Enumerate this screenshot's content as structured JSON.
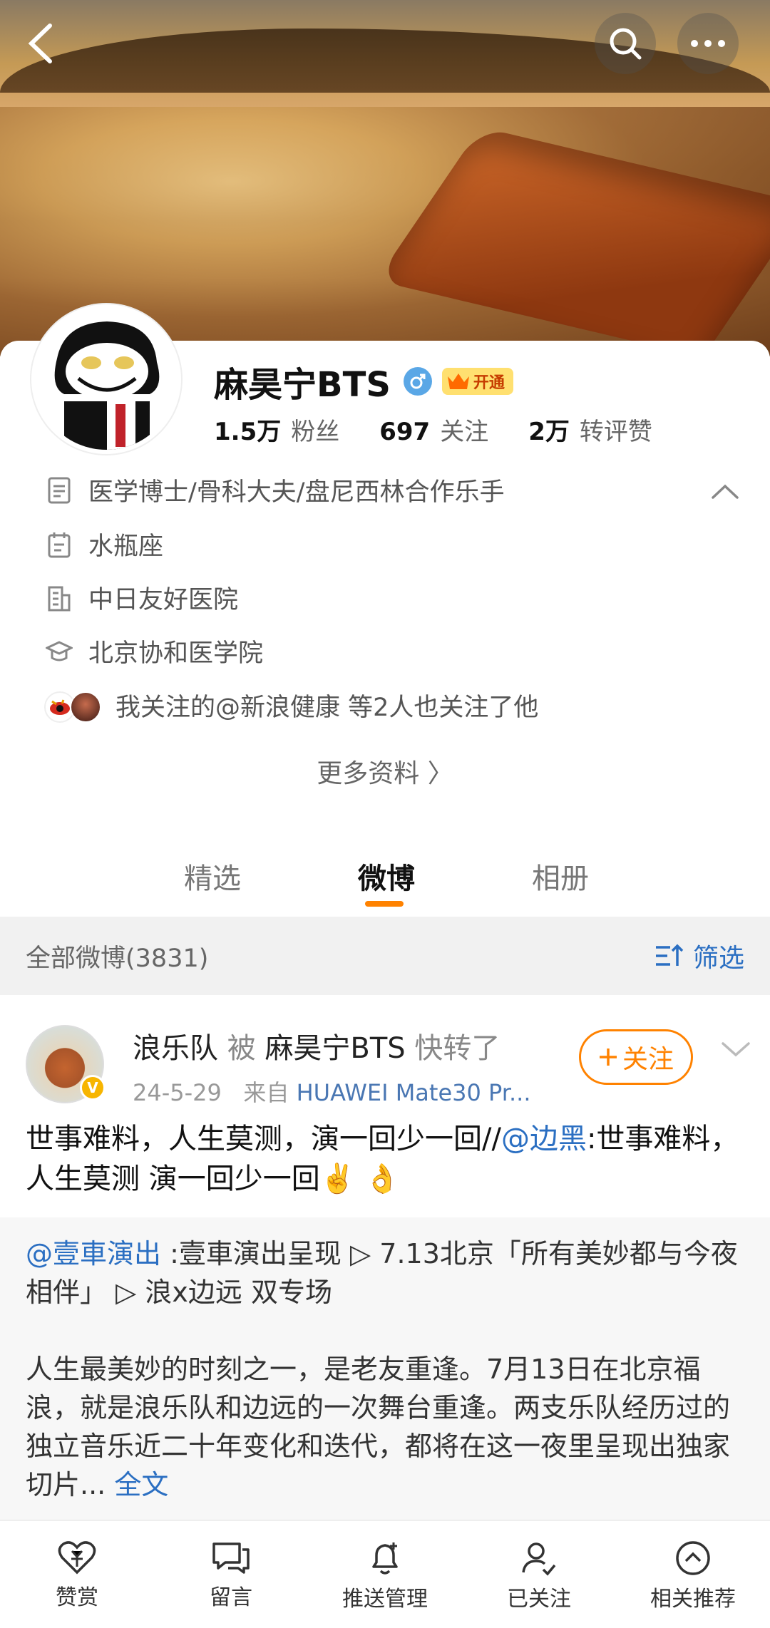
{
  "profile": {
    "name": "麻昊宁BTS",
    "vip_label": "开通",
    "stats": [
      {
        "value": "1.5万",
        "label": "粉丝"
      },
      {
        "value": "697",
        "label": "关注"
      },
      {
        "value": "2万",
        "label": "转评赞"
      }
    ],
    "bio": "医学博士/骨科大夫/盘尼西林合作乐手",
    "constellation": "水瓶座",
    "company": "中日友好医院",
    "school": "北京协和医学院",
    "mutual": "我关注的@新浪健康 等2人也关注了他",
    "more_info": "更多资料 〉"
  },
  "tabs": [
    "精选",
    "微博",
    "相册"
  ],
  "filter": {
    "count_label": "全部微博(3831)",
    "filter_label": "筛选"
  },
  "post": {
    "author": "浪乐队",
    "by": "被",
    "reposter": "麻昊宁BTS",
    "action": "快转了",
    "date": "24-5-29",
    "from": "来自",
    "device": "HUAWEI Mate30 Pr...",
    "follow_label": "关注",
    "text_main": "世事难料，人生莫测，演一回少一回//",
    "text_mention": "@边黑",
    "text_rest": ":世事难料，人生莫测 演一回少一回✌️ 👌",
    "repost_mention": "@壹車演出",
    "repost_line1": " :壹車演出呈现 ▷ 7.13北京「所有美妙都与今夜相伴」 ▷ 浪x边远 双专场",
    "repost_body": "人生最美妙的时刻之一，是老友重逢。7月13日在北京福浪，就是浪乐队和边远的一次舞台重逢。两支乐队经历过的独立音乐近二十年变化和迭代，都将在这一夜里呈现出独家切片...",
    "full_text": "全文"
  },
  "bottom_bar": [
    {
      "label": "赞赏",
      "icon": "reward-heart-icon"
    },
    {
      "label": "留言",
      "icon": "message-icon"
    },
    {
      "label": "推送管理",
      "icon": "bell-plus-icon"
    },
    {
      "label": "已关注",
      "icon": "user-check-icon"
    },
    {
      "label": "相关推荐",
      "icon": "circle-up-icon"
    }
  ],
  "colors": {
    "accent": "#ff8200",
    "link": "#2b6fc2",
    "filter_bg": "#f1f1f1"
  }
}
